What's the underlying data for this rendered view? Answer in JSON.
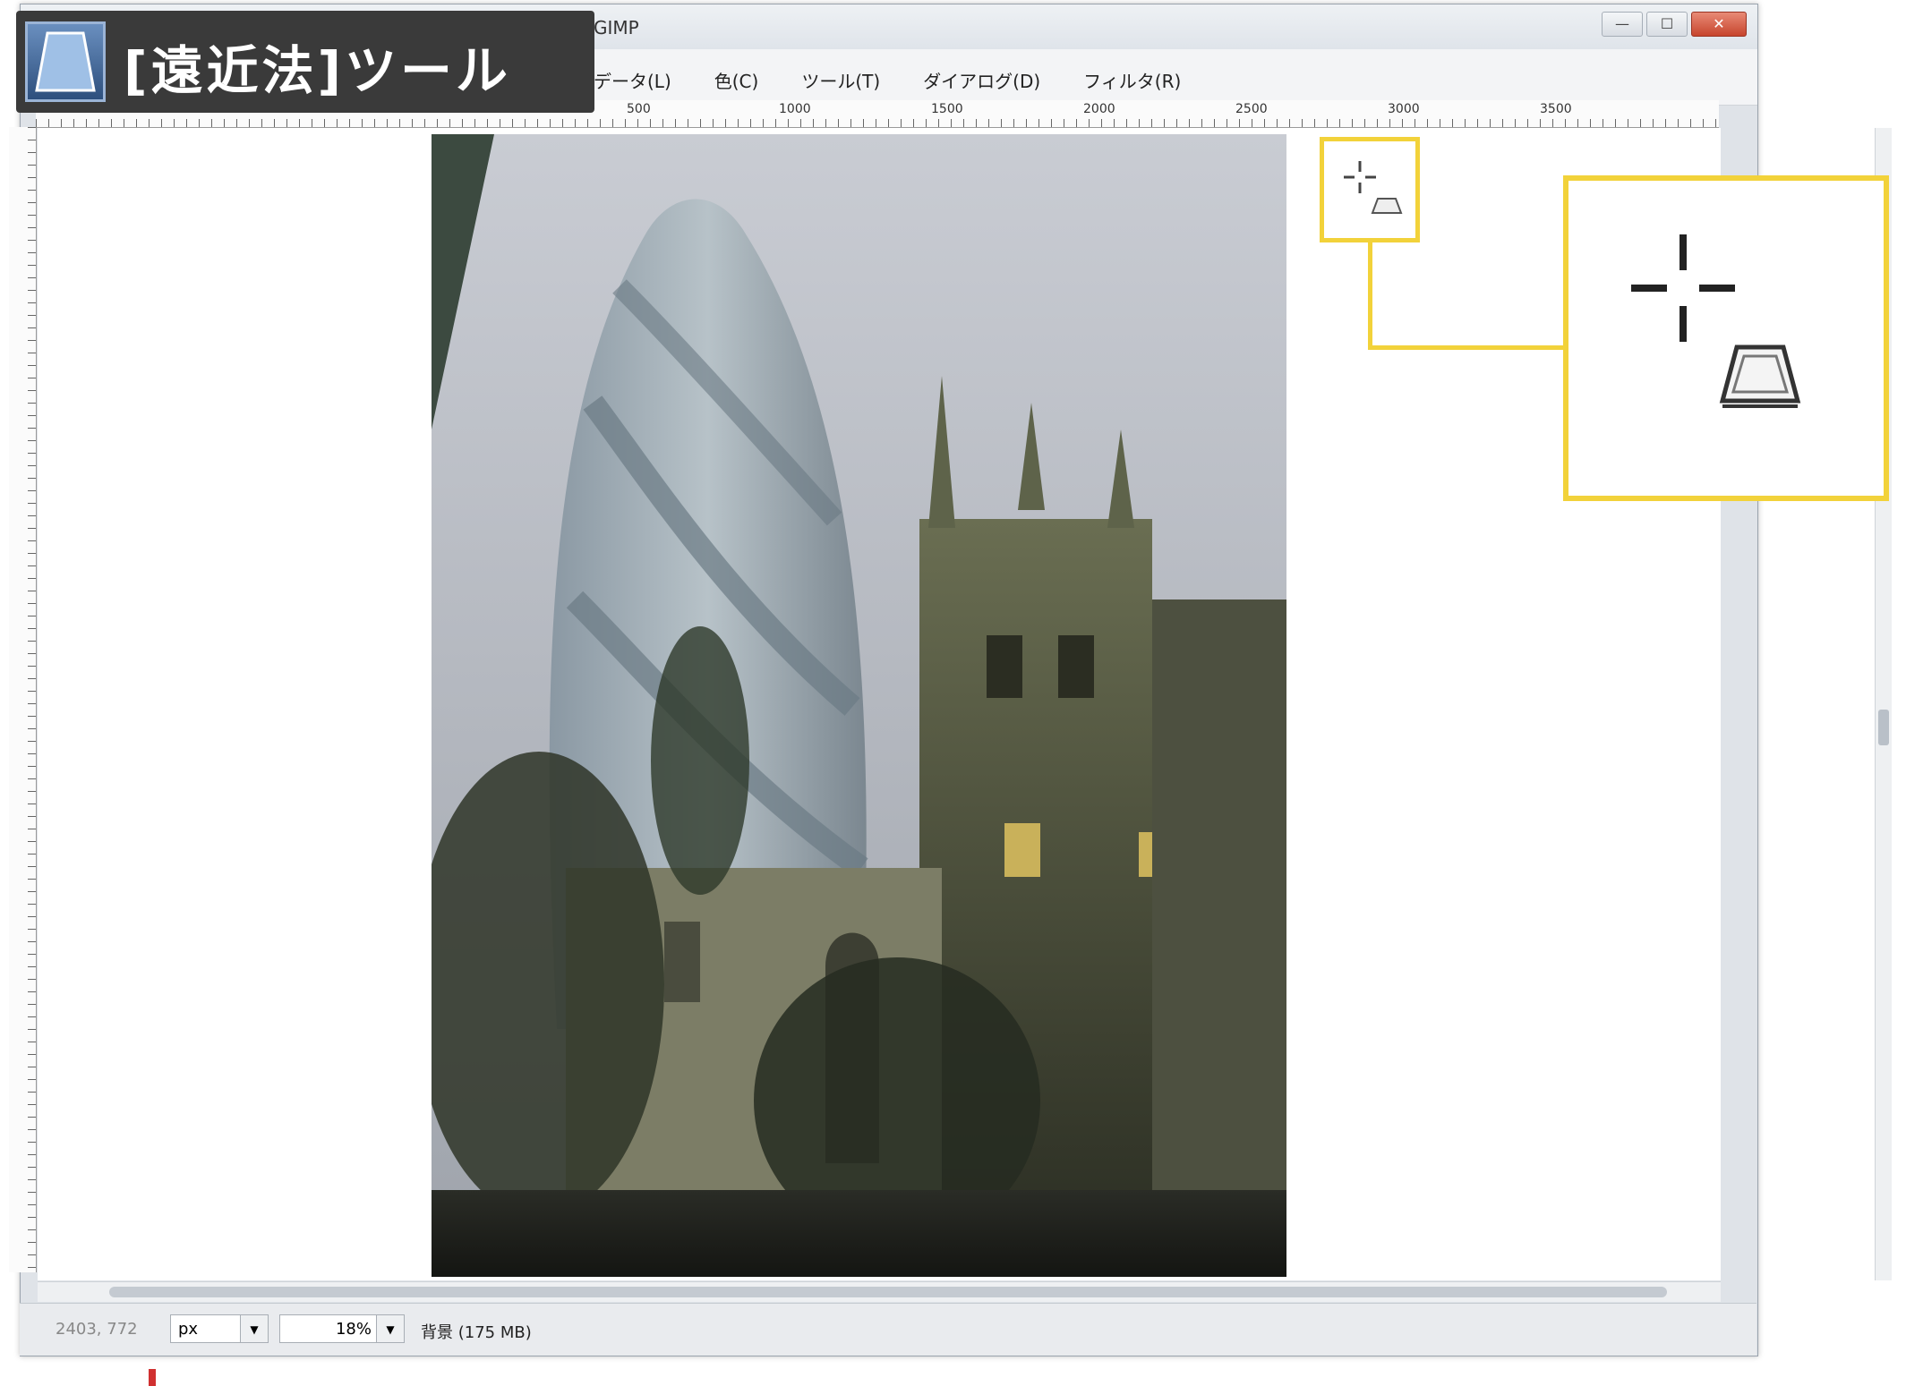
{
  "window": {
    "title": "GIMP",
    "controls": {
      "minimize": "—",
      "maximize": "☐",
      "close": "✕"
    }
  },
  "overlay": {
    "title": "[遠近法]ツール"
  },
  "menu": [
    {
      "label": "データ(L)"
    },
    {
      "label": "色(C)"
    },
    {
      "label": "ツール(T)"
    },
    {
      "label": "ダイアログ(D)"
    },
    {
      "label": "フィルタ(R)"
    }
  ],
  "ruler": {
    "top_labels": [
      "500",
      "1000",
      "1500",
      "2000",
      "2500",
      "3000",
      "3500"
    ]
  },
  "statusbar": {
    "coords": "2403, 772",
    "unit": "px",
    "zoom": "18%",
    "info": "背景 (175 MB)"
  },
  "colors": {
    "callout": "#f2d23a",
    "badge_bg": "#3a3a3a"
  }
}
